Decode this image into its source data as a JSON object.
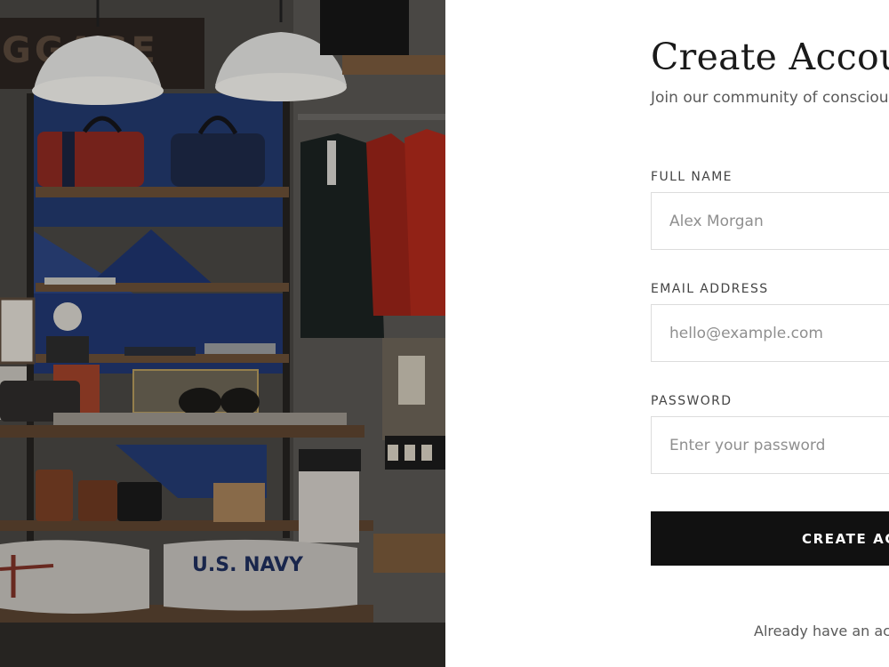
{
  "form": {
    "title": "Create Account",
    "subtitle": "Join our community of conscious",
    "full_name": {
      "label": "FULL NAME",
      "placeholder": "Alex Morgan",
      "value": ""
    },
    "email": {
      "label": "EMAIL ADDRESS",
      "placeholder": "hello@example.com",
      "value": ""
    },
    "password": {
      "label": "PASSWORD",
      "placeholder": "Enter your password",
      "value": ""
    },
    "submit_label": "CREATE ACCOUNT",
    "signin_prompt": "Already have an account?"
  },
  "photo": {
    "banner_text": "GGAGE",
    "pillow_text": "U.S. NAVY"
  },
  "colors": {
    "button_bg": "#111111",
    "button_text": "#ffffff",
    "input_border": "#dcdcdc",
    "text_dark": "#1a1a1a",
    "text_muted": "#5a5a5a"
  }
}
